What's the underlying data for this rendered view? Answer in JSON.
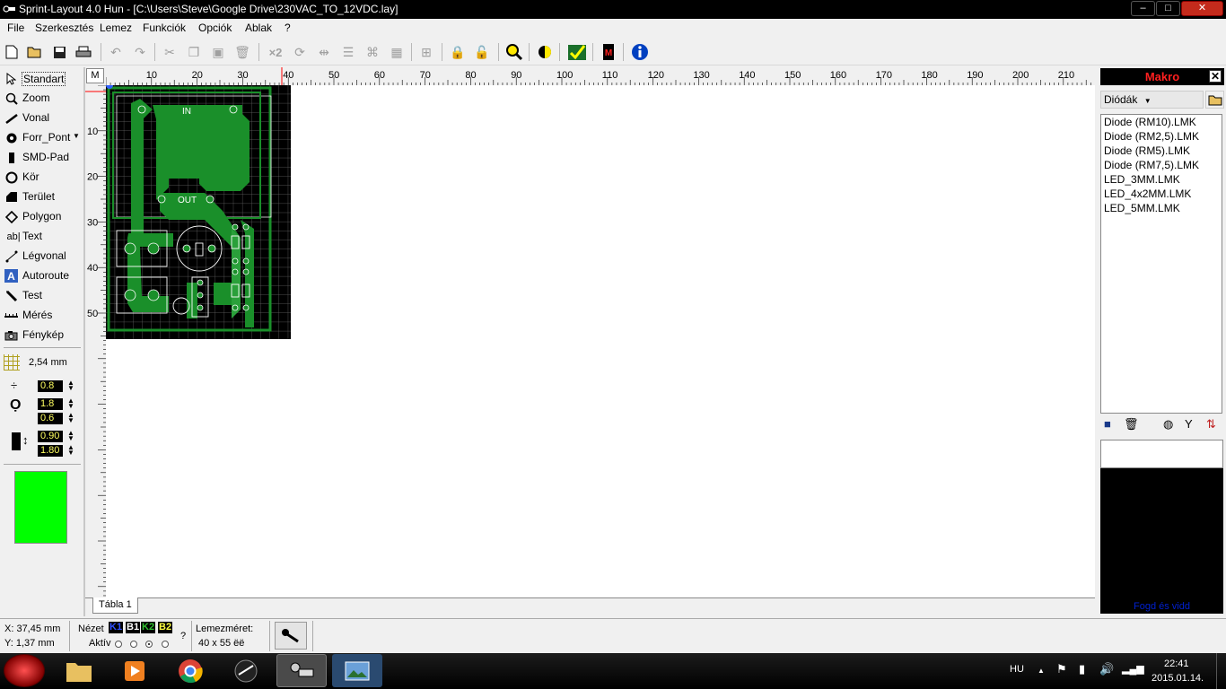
{
  "window": {
    "title": "Sprint-Layout 4.0 Hun - [C:\\Users\\Steve\\Google Drive\\230VAC_TO_12VDC.lay]",
    "minimize": "–",
    "maximize": "□",
    "close": "✕"
  },
  "menu": [
    "File",
    "Szerkesztés",
    "Lemez",
    "Funkciók",
    "Opciók",
    "Ablak",
    "?"
  ],
  "toolbar": {
    "mirror_x2": "×2"
  },
  "tools": [
    {
      "label": "Standart"
    },
    {
      "label": "Zoom"
    },
    {
      "label": "Vonal"
    },
    {
      "label": "Forr_Pont"
    },
    {
      "label": "SMD-Pad"
    },
    {
      "label": "Kör"
    },
    {
      "label": "Terület"
    },
    {
      "label": "Polygon"
    },
    {
      "label": "Text",
      "icon_text": "ab|"
    },
    {
      "label": "Légvonal"
    },
    {
      "label": "Autoroute"
    },
    {
      "label": "Test"
    },
    {
      "label": "Mérés"
    },
    {
      "label": "Fénykép"
    }
  ],
  "grid": {
    "label": "2,54 mm"
  },
  "params": {
    "track_width": "0.8",
    "pad_outer": "1.8",
    "pad_inner": "0.6",
    "smd_width": "0.90",
    "smd_height": "1.80"
  },
  "colors": {
    "active_layer": "#00ff00",
    "board": "#000000",
    "copper": "#1a8f2a",
    "makro_title": "#ff2020"
  },
  "ruler": {
    "m_label": "M",
    "top_ticks": [
      "10",
      "20",
      "30",
      "40",
      "50",
      "60",
      "70",
      "80",
      "90",
      "100",
      "110",
      "120",
      "130",
      "140",
      "150",
      "160",
      "170",
      "180",
      "190",
      "200",
      "210"
    ],
    "left_ticks": [
      "10",
      "20",
      "30",
      "40",
      "50"
    ]
  },
  "board_labels": {
    "in": "IN",
    "out": "OUT"
  },
  "tabs": [
    "Tábla 1"
  ],
  "makro": {
    "title": "Makro",
    "category": "Diódák",
    "items": [
      "Diode (RM10).LMK",
      "Diode (RM2,5).LMK",
      "Diode (RM5).LMK",
      "Diode (RM7,5).LMK",
      "LED_3MM.LMK",
      "LED_4x2MM.LMK",
      "LED_5MM.LMK"
    ],
    "hint": "Fogd és vidd"
  },
  "status": {
    "x": "X: 37,45 mm",
    "y": "Y: 1,37 mm",
    "view_label": "Nézet",
    "active_label": "Aktív",
    "layers": [
      {
        "name": "K1",
        "color": "#3050ff"
      },
      {
        "name": "B1",
        "color": "#ffffff"
      },
      {
        "name": "K2",
        "color": "#30c030"
      },
      {
        "name": "B2",
        "color": "#ffff40"
      }
    ],
    "question": "?",
    "size_label": "Lemezméret:",
    "size_value": "40 x 55 ëë"
  },
  "taskbar": {
    "lang": "HU",
    "time": "22:41",
    "date": "2015.01.14."
  }
}
